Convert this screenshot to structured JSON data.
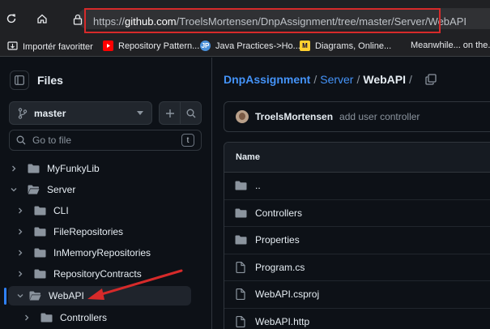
{
  "browser": {
    "url_prefix": "https://",
    "url_host": "github.com",
    "url_path": "/TroelsMortensen/DnpAssignment/tree/master/Server/WebAPI"
  },
  "bookmarks": [
    {
      "label": "Importér favoritter",
      "icon": "import-icon"
    },
    {
      "label": "Repository Pattern...",
      "icon": "youtube-icon",
      "color": "#ff0000"
    },
    {
      "label": "Java Practices->Ho...",
      "icon": "jp-icon",
      "color": "#4a90d9"
    },
    {
      "label": "Diagrams, Online...",
      "icon": "miro-icon",
      "color": "#ffd02f"
    },
    {
      "label": "Meanwhile... on the..."
    }
  ],
  "left": {
    "title": "Files",
    "branch": "master",
    "goto_placeholder": "Go to file",
    "goto_shortcut": "t",
    "tree": [
      {
        "label": "MyFunkyLib",
        "expanded": false
      },
      {
        "label": "Server",
        "expanded": true
      },
      {
        "label": "CLI",
        "expanded": false
      },
      {
        "label": "FileRepositories",
        "expanded": false
      },
      {
        "label": "InMemoryRepositories",
        "expanded": false
      },
      {
        "label": "RepositoryContracts",
        "expanded": false
      },
      {
        "label": "WebAPI",
        "expanded": true,
        "selected": true
      },
      {
        "label": "Controllers",
        "expanded": false
      }
    ]
  },
  "right": {
    "breadcrumb": {
      "repo": "DnpAssignment",
      "sep": "/",
      "folder": "Server",
      "current": "WebAPI"
    },
    "commit": {
      "author": "TroelsMortensen",
      "message": "add user controller"
    },
    "table": {
      "header": "Name",
      "rows": [
        {
          "name": "..",
          "type": "folder"
        },
        {
          "name": "Controllers",
          "type": "folder"
        },
        {
          "name": "Properties",
          "type": "folder"
        },
        {
          "name": "Program.cs",
          "type": "file"
        },
        {
          "name": "WebAPI.csproj",
          "type": "file"
        },
        {
          "name": "WebAPI.http",
          "type": "file"
        }
      ]
    }
  },
  "colors": {
    "annotation": "#d62a2a",
    "link": "#4493f8",
    "selected_indicator": "#2f81f7"
  }
}
